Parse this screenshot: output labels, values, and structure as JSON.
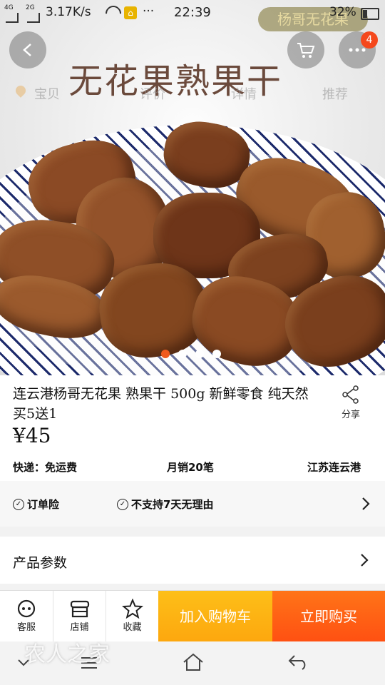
{
  "status_bar": {
    "signal_1": "4G",
    "signal_2": "2G",
    "net_speed": "3.17K/s",
    "more": "···",
    "time": "22:39",
    "battery": "32%"
  },
  "hero": {
    "brand_tag": "杨哥无花果",
    "title_overlay": "无花果熟果干",
    "tabs": [
      "宝贝",
      "评价",
      "详情",
      "推荐"
    ],
    "cart_badge": "4",
    "carousel": {
      "count": 4,
      "active_index": 0,
      "active_color": "#f05a1e"
    }
  },
  "product": {
    "title": "连云港杨哥无花果  熟果干  500g  新鲜零食  纯天然    买5送1",
    "share_label": "分享",
    "price": "¥45",
    "shipping": "快递：免运费",
    "monthly_sales": "月销20笔",
    "location": "江苏连云港"
  },
  "services": {
    "item_1": "订单险",
    "item_2": "不支持7天无理由"
  },
  "params": {
    "label": "产品参数"
  },
  "bottom_bar": {
    "service": "客服",
    "shop": "店铺",
    "favorite": "收藏",
    "add_to_cart": "加入购物车",
    "buy_now": "立即购买",
    "cart_color": "#fdb314",
    "buy_color": "#ff6215"
  },
  "watermark": "农人之家"
}
